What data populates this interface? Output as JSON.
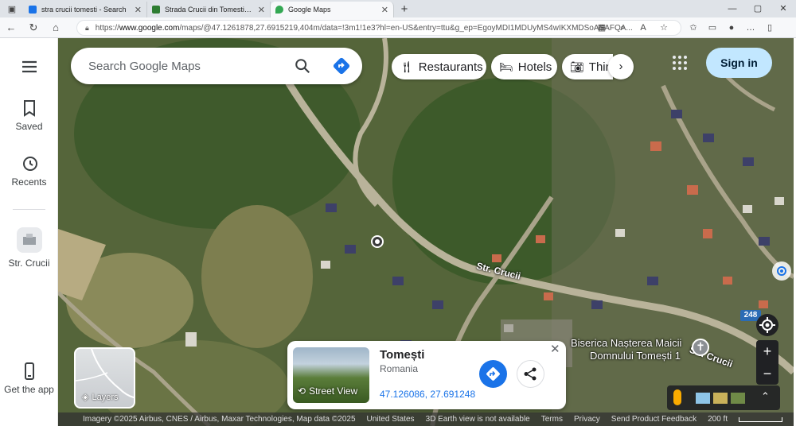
{
  "browser": {
    "tabs": [
      {
        "title": "stra crucii tomesti - Search",
        "favicon_color": "#1a73e8"
      },
      {
        "title": "Strada Crucii din Tomesti, Iasi pe harta",
        "favicon_color": "#2e7d32"
      },
      {
        "title": "Google Maps",
        "favicon_color": "#34a853"
      }
    ],
    "url_prefix": "https://",
    "url_host": "www.google.com",
    "url_rest": "/maps/@47.1261878,27.6915219,404m/data=!3m1!1e3?hl=en-US&entry=ttu&g_ep=EgoyMDI1MDUyMS4wIKXMDSoASAFQA..."
  },
  "rail": {
    "menu_icon": "menu-icon",
    "saved_label": "Saved",
    "recents_label": "Recents",
    "recent_place_label": "Str. Crucii",
    "get_app_label": "Get the app"
  },
  "search": {
    "placeholder": "Search Google Maps"
  },
  "chips": [
    {
      "label": "Restaurants",
      "icon": "fork-knife-icon"
    },
    {
      "label": "Hotels",
      "icon": "bed-icon"
    },
    {
      "label": "Things to do",
      "icon": "camera-icon"
    }
  ],
  "signin_label": "Sign in",
  "map": {
    "street_labels": [
      "Str. Crucii",
      "Str. Crucii"
    ],
    "poi_label_line1": "Biserica Nașterea Maicii",
    "poi_label_line2": "Domnului Tomești 1",
    "route_number": "248",
    "layers_label": "Layers"
  },
  "place_card": {
    "name": "Tomești",
    "country": "Romania",
    "coordinates": "47.126086, 27.691248",
    "street_view_label": "Street View"
  },
  "attribution": {
    "imagery": "Imagery ©2025 Airbus, CNES / Airbus, Maxar Technologies, Map data ©2025",
    "country": "United States",
    "earth_note": "3D Earth view is not available",
    "terms": "Terms",
    "privacy": "Privacy",
    "feedback": "Send Product Feedback",
    "scale": "200 ft"
  },
  "colors": {
    "accent_blue": "#1a73e8",
    "signin_bg": "#c2e7ff"
  }
}
